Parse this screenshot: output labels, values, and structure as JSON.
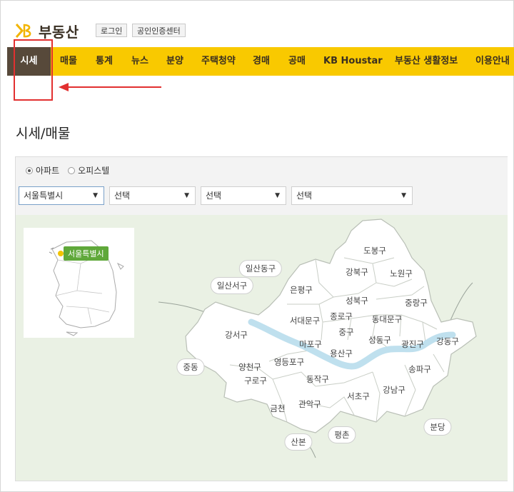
{
  "header": {
    "logo_text": "부동산",
    "login_label": "로그인",
    "cert_label": "공인인증센터"
  },
  "nav": {
    "items": [
      "시세",
      "매물",
      "통계",
      "뉴스",
      "분양",
      "주택청약",
      "경매",
      "공매",
      "KB Houstar",
      "부동산 생활정보",
      "이용안내"
    ],
    "active_index": 0
  },
  "page_title": "시세/매물",
  "filters": {
    "property_types": [
      {
        "label": "아파트",
        "selected": true
      },
      {
        "label": "오피스텔",
        "selected": false
      }
    ],
    "selects": [
      "서울특별시",
      "선택",
      "선택",
      "선택"
    ]
  },
  "map": {
    "inset_tooltip": "서울특별시",
    "districts": [
      "도봉구",
      "강북구",
      "노원구",
      "은평구",
      "성북구",
      "중랑구",
      "종로구",
      "동대문구",
      "서대문구",
      "중구",
      "마포구",
      "성동구",
      "광진구",
      "강동구",
      "강서구",
      "용산구",
      "양천구",
      "영등포구",
      "구로구",
      "동작구",
      "송파구",
      "서초구",
      "강남구",
      "금천",
      "관악구"
    ],
    "outer_areas": [
      "일산동구",
      "일산서구",
      "중동",
      "평촌",
      "산본",
      "분당"
    ]
  },
  "colors": {
    "nav_bg": "#f9c900",
    "nav_active": "#57493a",
    "annotation": "#e23030",
    "map_bg": "#eaf1e4",
    "river": "#bfe0ee",
    "tooltip": "#5fa83a"
  }
}
